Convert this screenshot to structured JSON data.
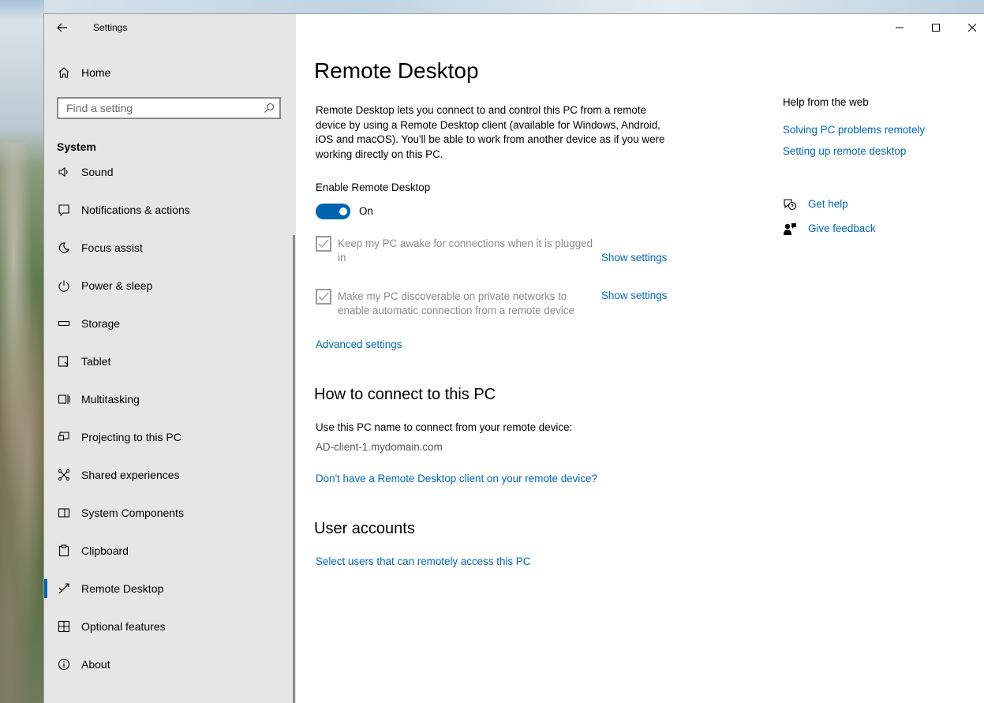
{
  "window": {
    "title": "Settings",
    "controls": {
      "minimize": "minimize",
      "maximize": "maximize",
      "close": "close"
    }
  },
  "sidebar": {
    "home_label": "Home",
    "search_placeholder": "Find a setting",
    "section_title": "System",
    "items": [
      {
        "label": "Sound",
        "icon": "speaker-icon"
      },
      {
        "label": "Notifications & actions",
        "icon": "notification-icon"
      },
      {
        "label": "Focus assist",
        "icon": "moon-icon"
      },
      {
        "label": "Power & sleep",
        "icon": "power-icon"
      },
      {
        "label": "Storage",
        "icon": "storage-icon"
      },
      {
        "label": "Tablet",
        "icon": "tablet-icon"
      },
      {
        "label": "Multitasking",
        "icon": "multitasking-icon"
      },
      {
        "label": "Projecting to this PC",
        "icon": "projector-icon"
      },
      {
        "label": "Shared experiences",
        "icon": "shared-icon"
      },
      {
        "label": "System Components",
        "icon": "components-icon"
      },
      {
        "label": "Clipboard",
        "icon": "clipboard-icon"
      },
      {
        "label": "Remote Desktop",
        "icon": "remote-desktop-icon",
        "active": true
      },
      {
        "label": "Optional features",
        "icon": "features-icon"
      },
      {
        "label": "About",
        "icon": "info-icon"
      }
    ]
  },
  "main": {
    "title": "Remote Desktop",
    "description": "Remote Desktop lets you connect to and control this PC from a remote device by using a Remote Desktop client (available for Windows, Android, iOS and macOS). You'll be able to work from another device as if you were working directly on this PC.",
    "enable_label": "Enable Remote Desktop",
    "toggle_state": "On",
    "options": [
      {
        "label": "Keep my PC awake for connections when it is plugged in",
        "checked": true,
        "link": "Show settings"
      },
      {
        "label": "Make my PC discoverable on private networks to enable automatic connection from a remote device",
        "checked": true,
        "link": "Show settings"
      }
    ],
    "advanced_link": "Advanced settings",
    "connect_heading": "How to connect to this PC",
    "connect_text": "Use this PC name to connect from your remote device:",
    "pc_name": "AD-client-1.mydomain.com",
    "client_link": "Don't have a Remote Desktop client on your remote device?",
    "accounts_heading": "User accounts",
    "accounts_link": "Select users that can remotely access this PC"
  },
  "help": {
    "title": "Help from the web",
    "links": [
      "Solving PC problems remotely",
      "Setting up remote desktop"
    ],
    "get_help": "Get help",
    "feedback": "Give feedback"
  },
  "colors": {
    "accent": "#0063b1",
    "link": "#0067b8",
    "sidebar_bg": "#e6e6e6"
  }
}
